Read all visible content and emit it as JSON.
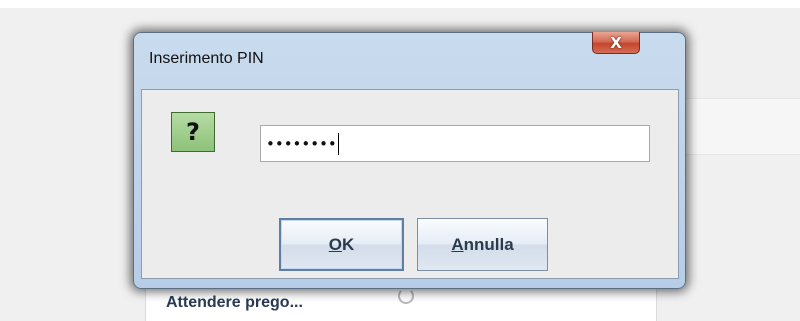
{
  "background": {
    "status_text": "Attendere prego..."
  },
  "dialog": {
    "title": "Inserimento PIN",
    "close_label": "X",
    "icon": {
      "name": "question-icon",
      "glyph": "?",
      "color": "#8cc278"
    },
    "pin_field": {
      "value": "••••••••",
      "masked": true,
      "length": 8
    },
    "buttons": {
      "ok": {
        "mnemonic": "O",
        "rest": "K",
        "label": "OK"
      },
      "cancel": {
        "mnemonic": "A",
        "rest": "nnulla",
        "label": "Annulla"
      }
    }
  },
  "colors": {
    "title_bar": "#c9dbee",
    "close_button": "#c2462d",
    "button_text": "#2b3a4f"
  }
}
